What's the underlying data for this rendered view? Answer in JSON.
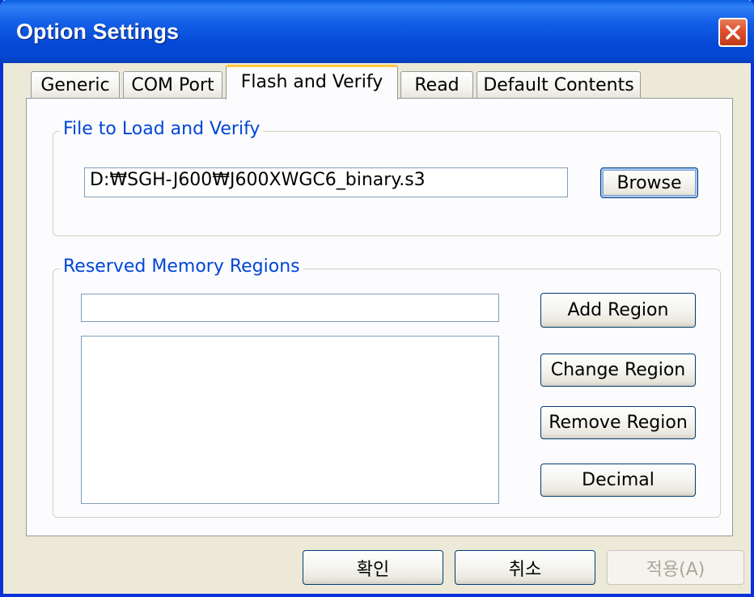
{
  "window": {
    "title": "Option Settings",
    "close_icon": "close-icon"
  },
  "tabs": [
    {
      "label": "Generic",
      "active": false
    },
    {
      "label": "COM Port",
      "active": false
    },
    {
      "label": "Flash and Verify",
      "active": true
    },
    {
      "label": "Read",
      "active": false
    },
    {
      "label": "Default Contents",
      "active": false
    }
  ],
  "file_group": {
    "label": "File to Load and Verify",
    "path_value": "D:₩SGH-J600₩J600XWGC6_binary.s3",
    "browse_label": "Browse"
  },
  "memory_group": {
    "label": "Reserved Memory Regions",
    "region_input_value": "",
    "regions": [],
    "add_label": "Add Region",
    "change_label": "Change Region",
    "remove_label": "Remove Region",
    "decimal_label": "Decimal"
  },
  "footer": {
    "ok_label": "확인",
    "cancel_label": "취소",
    "apply_label": "적용(A)"
  },
  "colors": {
    "titlebar": "#0449d6",
    "group_label": "#0046d5",
    "active_tab_highlight": "#ffc83c",
    "close_button": "#e0532e"
  }
}
